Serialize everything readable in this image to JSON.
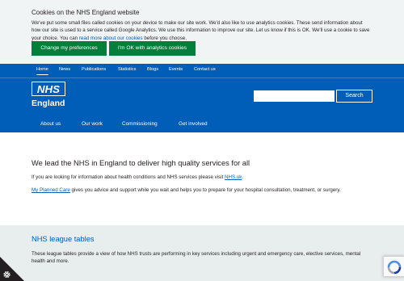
{
  "cookie_banner": {
    "title": "Cookies on the NHS England website",
    "text_before_link": "We've put some small files called cookies on your device to make our site work. We'd also like to use analytics cookies. These send information about how our site is used to a service called Google Analytics. We use this information to improve our site. Let us know if this is OK. We'll use a cookie to save your choice. You can ",
    "link_text": "read more about our cookies",
    "text_after_link": " before you choose.",
    "preferences_button": "Change my preferences",
    "accept_button": "I'm OK with analytics cookies"
  },
  "top_nav": {
    "items": [
      "Home",
      "News",
      "Publications",
      "Statistics",
      "Blogs",
      "Events",
      "Contact us"
    ],
    "active": "Home"
  },
  "logo": {
    "nhs": "NHS",
    "england": "England"
  },
  "search": {
    "placeholder": "",
    "button_label": "Search"
  },
  "main_nav": {
    "items": [
      "About us",
      "Our work",
      "Commissioning",
      "Get involved"
    ]
  },
  "main": {
    "headline": "We lead the NHS in England to deliver high quality services for all",
    "p1_before_link": "If you are looking for information about health conditions and NHS services please visit ",
    "p1_link": "NHS.uk",
    "p1_after_link": ".",
    "p2_link": "My Planned Care",
    "p2_after_link": " gives you advice and support while you wait and helps you to prepare for your hospital consultation, treatment, or surgery."
  },
  "league_tables": {
    "title": "NHS league tables",
    "text": "These league tables provide a view of how NHS trusts are performing in key services including urgent and emergency care, elective services, mental health and more."
  },
  "icons": {
    "cookie_settings": "gear-icon",
    "recaptcha": "recaptcha-icon"
  },
  "colors": {
    "nhs_blue": "#005eb8",
    "cookie_green": "#007f3b",
    "banner_bg": "#f0f4f5",
    "section_bg": "#e8edee",
    "text": "#231f20"
  }
}
